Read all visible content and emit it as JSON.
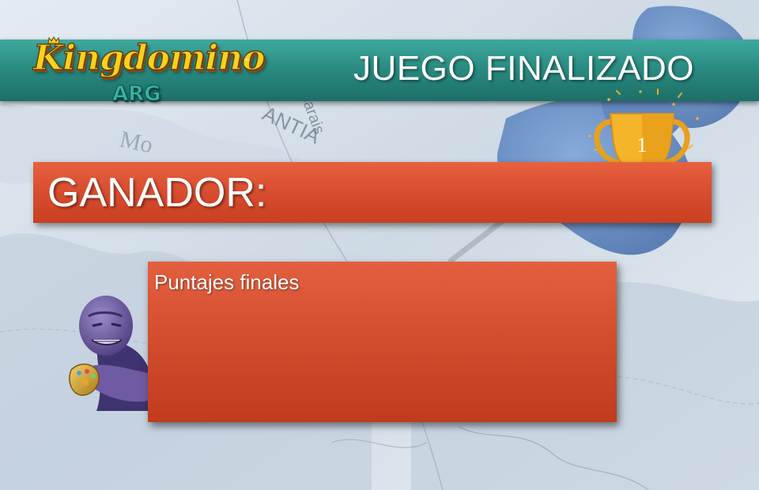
{
  "header": {
    "logo_text": "Kingdomino",
    "logo_tm": "™",
    "logo_sub": "ARG",
    "title": "JUEGO FINALIZADO"
  },
  "winner": {
    "label": "GANADOR:",
    "trophy_number": "1",
    "icon": "trophy-icon"
  },
  "scores": {
    "title": "Puntajes finales"
  },
  "background": {
    "map_labels": [
      "Mo",
      "ANTIA",
      "parais"
    ]
  },
  "colors": {
    "header_teal": "#2a8c82",
    "panel_red": "#d5492c",
    "logo_gold": "#f7d21c",
    "trophy_gold": "#f5b52a"
  }
}
